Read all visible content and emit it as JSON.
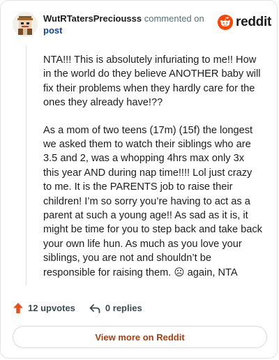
{
  "header": {
    "username": "WutRTatersPreciousss",
    "action_text": " commented on",
    "post_link": "post",
    "avatar_icon": "pixel-avatar-icon"
  },
  "brand": {
    "name": "reddit",
    "icon": "reddit-alien-icon",
    "color": "#ff4500"
  },
  "comment": {
    "paragraphs": [
      "NTA!!! This is absolutely infuriating to me!! How in the world do they believe ANOTHER baby will fix their problems when they hardly care for the ones they already have!??",
      "As a mom of two teens (17m) (15f) the longest we asked them to watch their siblings who are 3.5 and 2, was a whopping 4hrs max only 3x this year AND during nap time!!!! Lol just crazy to me. It is the PARENTS job to raise their children! I’m so sorry you’re having to act as a parent at such a young age!! As sad as it is, it might be time for you to step back and take back your own life hun. As much as you love your siblings, you are not and shouldn’t be responsible for raising them. ☹ again, NTA"
    ]
  },
  "footer": {
    "upvotes": "12 upvotes",
    "replies": "0 replies",
    "upvote_icon": "upvote-arrow-icon",
    "reply_icon": "reply-arrow-icon",
    "upvote_color": "#e8501b"
  },
  "cta": {
    "label": "View more on Reddit"
  }
}
